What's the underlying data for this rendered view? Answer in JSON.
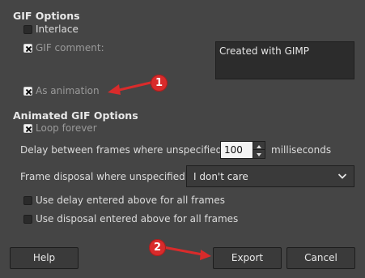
{
  "gif_options": {
    "heading": "GIF Options",
    "interlace": {
      "label": "Interlace",
      "checked": false
    },
    "gif_comment": {
      "label": "GIF comment:",
      "checked": true,
      "value": "Created with GIMP"
    },
    "as_animation": {
      "label": "As animation",
      "checked": true
    }
  },
  "animated_options": {
    "heading": "Animated GIF Options",
    "loop_forever": {
      "label": "Loop forever",
      "checked": true
    },
    "delay": {
      "label": "Delay between frames where unspecified:",
      "value": "100",
      "unit": "milliseconds"
    },
    "disposal": {
      "label": "Frame disposal where unspecified:",
      "value": "I don't care"
    },
    "use_delay": {
      "label": "Use delay entered above for all frames",
      "checked": false
    },
    "use_disposal": {
      "label": "Use disposal entered above for all frames",
      "checked": false
    }
  },
  "buttons": {
    "help": "Help",
    "export": "Export",
    "cancel": "Cancel"
  },
  "annotations": {
    "badge_1": "1",
    "badge_2": "2",
    "color": "#d92b2b"
  },
  "icons": {
    "checkmark": "x-check-icon",
    "spin_up": "triangle-up-icon",
    "spin_down": "triangle-down-icon",
    "dropdown": "chevron-down-icon"
  }
}
